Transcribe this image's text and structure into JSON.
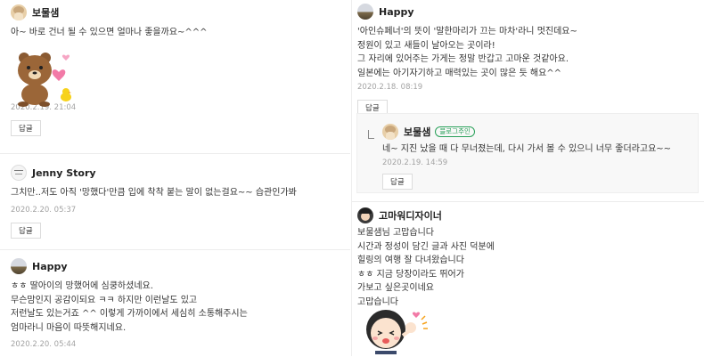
{
  "reply_label": "답글",
  "comments": [
    {
      "author": "보물샘",
      "text": "아~ 바로 건너 될 수 있으면 얼마나 좋을까요~^^^",
      "date": "2020.2.19. 21:04",
      "sticker": "brown-bear-sticker"
    },
    {
      "author": "Jenny Story",
      "text": "그치만..저도 아직 '망했다'만큼 입에 착착 붙는 말이 없는걸요~~ 습관인가봐",
      "date": "2020.2.20. 05:37"
    },
    {
      "author": "Happy",
      "text": "ㅎㅎ 딸아이의 망했어에 심쿵하셨네요.\n무슨맘인지 공감이되요 ㅋㅋ 하지만 이런날도 있고\n저런날도 있는거죠 ^^ 이렇게 가까이에서 세심히 소통해주시는\n엄마라니 마음이 따뜻해지네요.",
      "date": "2020.2.20. 05:44"
    },
    {
      "author": "Happy",
      "text": "'아인슈페너'의 뜻이 '말한마리가 끄는 마차'라니 멋진데요~\n정원이 있고 새들이 날아오는 곳이라!\n그 자리에 있어주는 가게는 정말 반갑고 고마운 것같아요.\n일본에는 아기자기하고 매력있는 곳이 많은 듯 해요^^",
      "date": "2020.2.18. 08:19"
    },
    {
      "author": "보물샘",
      "badge": "블로그주인",
      "text": "네~ 지진 났을 때 다 무너졌는데, 다시 가서 볼 수 있으니 너무 좋더라고요~~",
      "date": "2020.2.19. 14:59"
    },
    {
      "author": "고마워디자이너",
      "text": "보물샘님 고맙습니다\n시간과 정성이 담긴 글과 사진 덕분에\n힐링의 여행 잘 다녀왔습니다\nㅎㅎ 지금 당장이라도 뛰어가\n가보고 싶은곳이네요\n고맙습니다",
      "sticker": "waving-girl-sticker"
    }
  ]
}
